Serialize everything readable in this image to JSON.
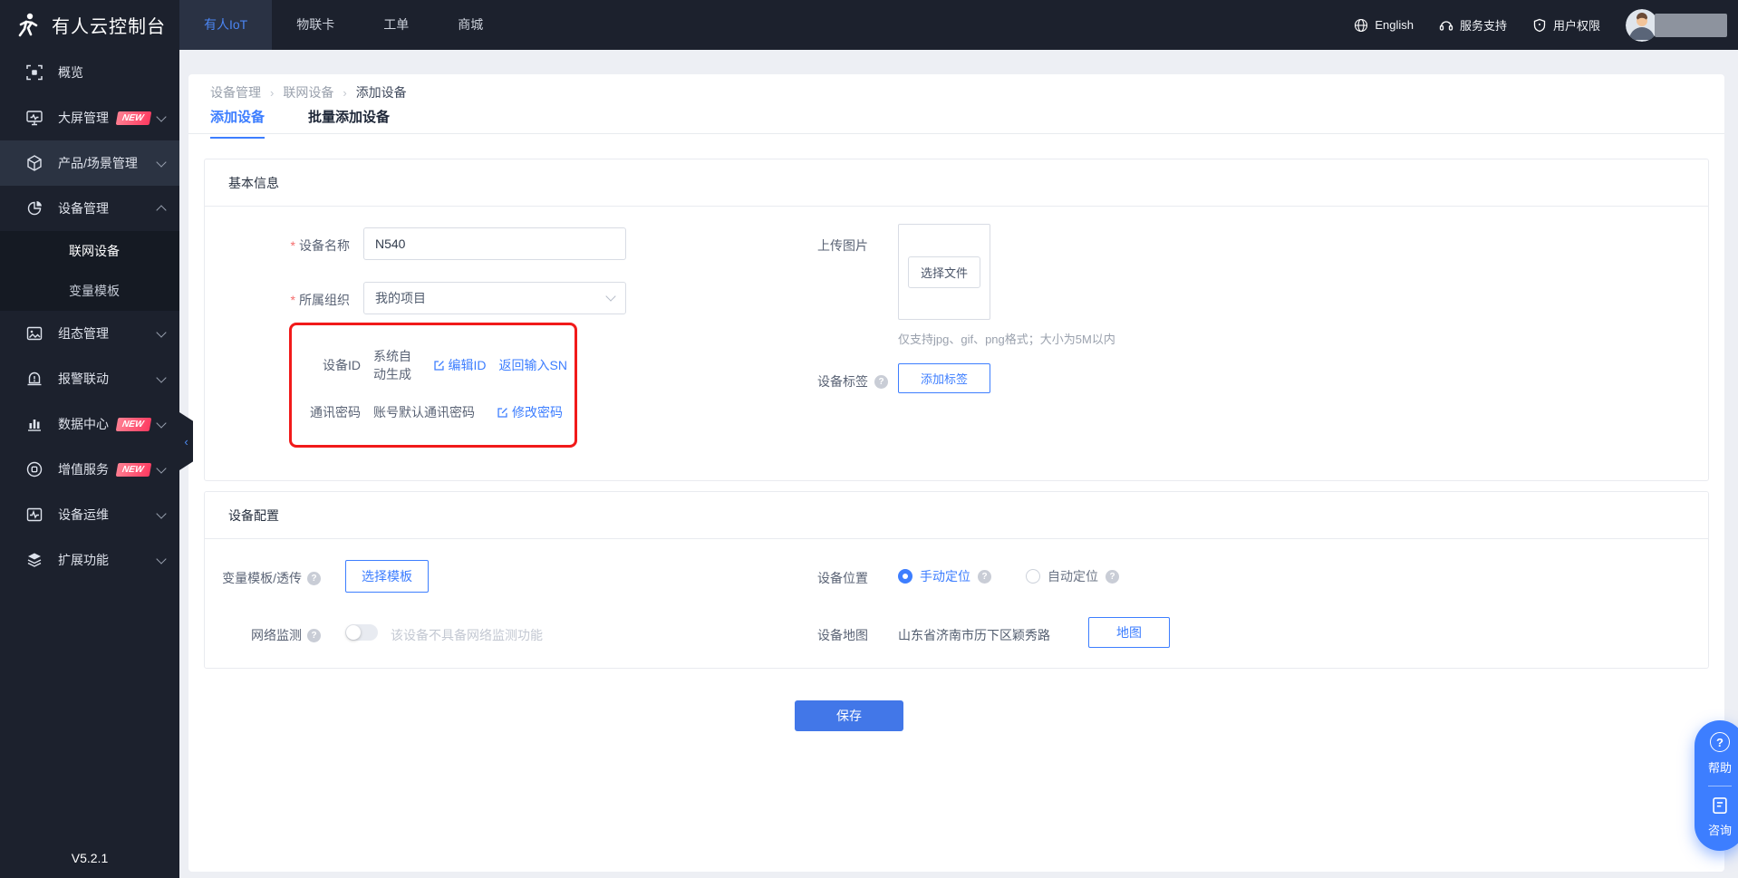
{
  "topbar": {
    "title": "有人云控制台",
    "nav": [
      {
        "label": "有人IoT"
      },
      {
        "label": "物联卡"
      },
      {
        "label": "工单"
      },
      {
        "label": "商城"
      }
    ],
    "lang": "English",
    "support": "服务支持",
    "permission": "用户权限"
  },
  "sidebar": {
    "items": [
      {
        "label": "概览"
      },
      {
        "label": "大屏管理",
        "badge": "NEW"
      },
      {
        "label": "产品/场景管理"
      },
      {
        "label": "设备管理"
      },
      {
        "label": "组态管理"
      },
      {
        "label": "报警联动"
      },
      {
        "label": "数据中心",
        "badge": "NEW"
      },
      {
        "label": "增值服务",
        "badge": "NEW"
      },
      {
        "label": "设备运维"
      },
      {
        "label": "扩展功能"
      }
    ],
    "submenu": [
      {
        "label": "联网设备"
      },
      {
        "label": "变量模板"
      }
    ],
    "version": "V5.2.1"
  },
  "breadcrumb": {
    "items": [
      "设备管理",
      "联网设备",
      "添加设备"
    ]
  },
  "tabs": {
    "add": "添加设备",
    "batch": "批量添加设备"
  },
  "basic": {
    "title": "基本信息",
    "name_label": "设备名称",
    "name_value": "N540",
    "org_label": "所属组织",
    "org_value": "我的项目",
    "id_label": "设备ID",
    "id_value": "系统自动生成",
    "id_edit": "编辑ID",
    "id_sn": "返回输入SN",
    "pwd_label": "通讯密码",
    "pwd_value": "账号默认通讯密码",
    "pwd_edit": "修改密码",
    "upload_label": "上传图片",
    "upload_button": "选择文件",
    "upload_hint": "仅支持jpg、gif、png格式；大小为5M以内",
    "tag_label": "设备标签",
    "tag_button": "添加标签"
  },
  "config": {
    "title": "设备配置",
    "template_label": "变量模板/透传",
    "template_button": "选择模板",
    "network_label": "网络监测",
    "network_hint": "该设备不具备网络监测功能",
    "location_label": "设备位置",
    "manual": "手动定位",
    "auto": "自动定位",
    "map_label": "设备地图",
    "map_value": "山东省济南市历下区颖秀路",
    "map_button": "地图"
  },
  "save": "保存",
  "floating": {
    "help": "帮助",
    "consult": "咨询"
  },
  "colors": {
    "accent": "#3d7eff",
    "danger_box": "#f11a1a",
    "topbar_bg": "#1c212d",
    "badge_gradient_from": "#ff8193",
    "badge_gradient_to": "#fd3a60",
    "page_bg": "#edeff4"
  }
}
